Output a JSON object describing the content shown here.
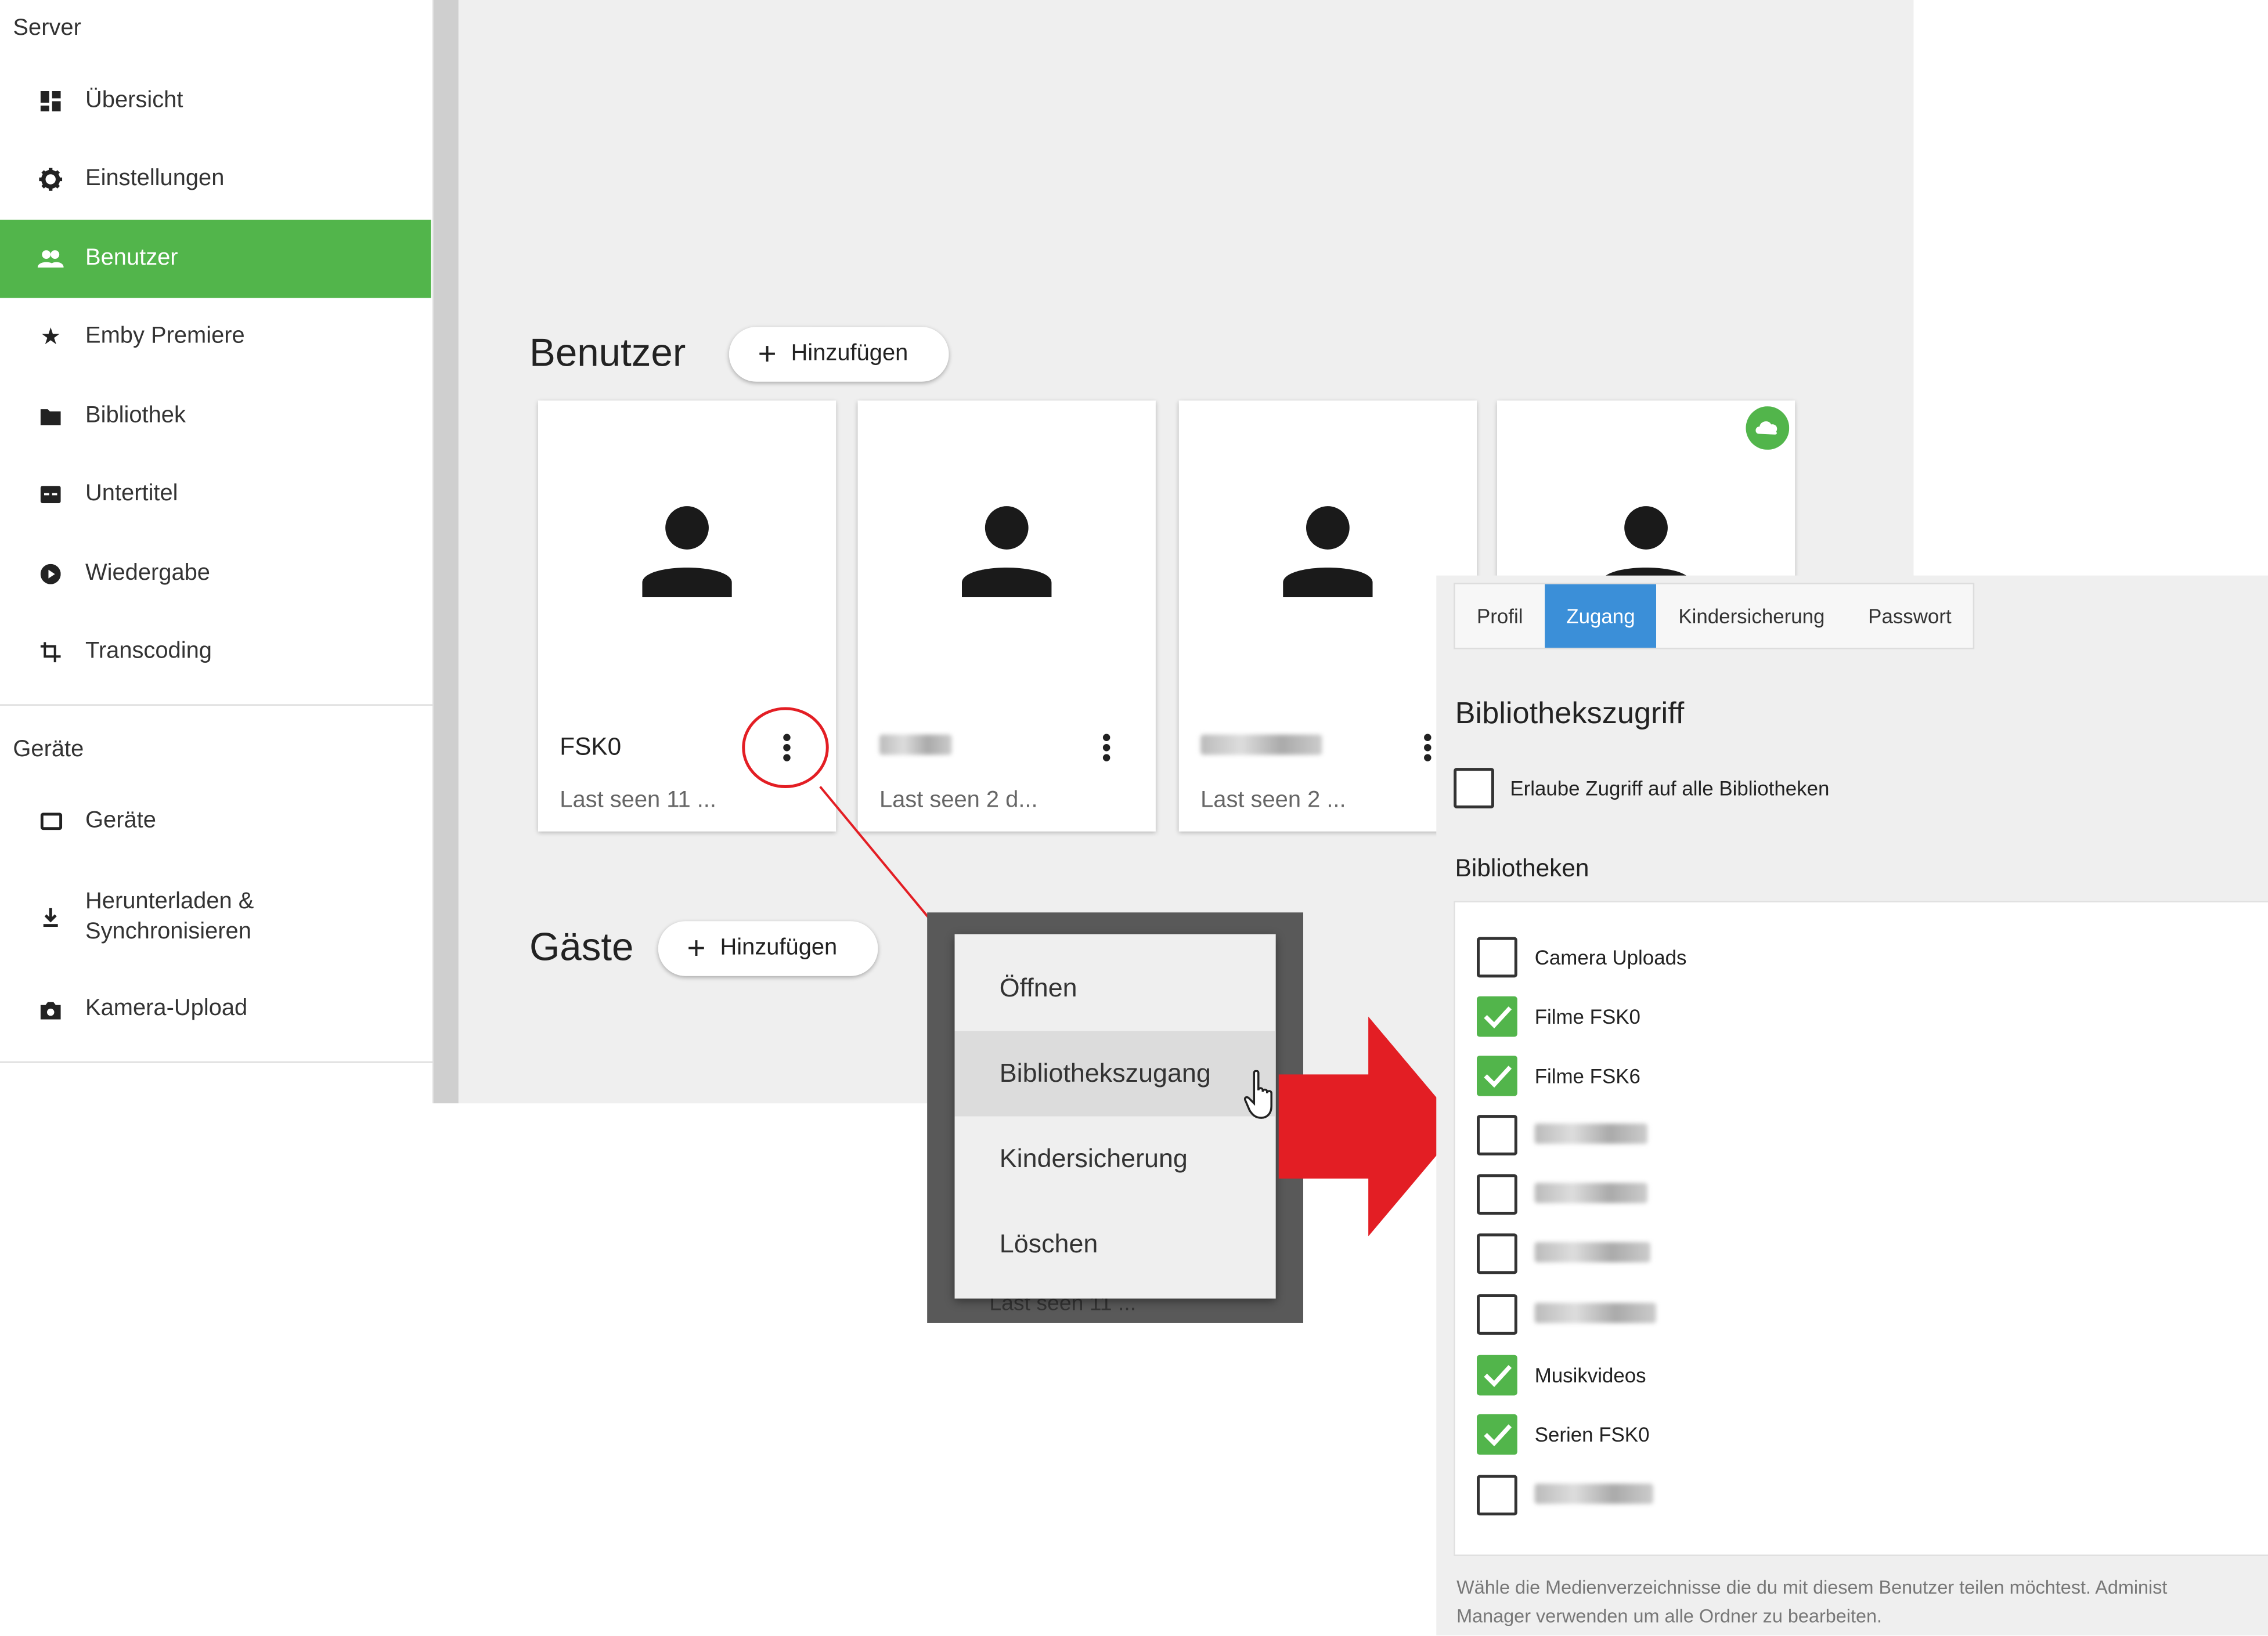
{
  "sidebar": {
    "sections": [
      {
        "title": "Server"
      },
      {
        "title": "Geräte"
      }
    ],
    "server_items": [
      {
        "label": "Übersicht",
        "icon": "dashboard-icon"
      },
      {
        "label": "Einstellungen",
        "icon": "gear-icon"
      },
      {
        "label": "Benutzer",
        "icon": "people-icon",
        "active": true
      },
      {
        "label": "Emby Premiere",
        "icon": "star-icon"
      },
      {
        "label": "Bibliothek",
        "icon": "folder-icon"
      },
      {
        "label": "Untertitel",
        "icon": "subtitles-icon"
      },
      {
        "label": "Wiedergabe",
        "icon": "play-circle-icon"
      },
      {
        "label": "Transcoding",
        "icon": "transform-icon"
      }
    ],
    "device_items": [
      {
        "label": "Geräte",
        "icon": "tablet-icon"
      },
      {
        "label_line1": "Herunterladen &",
        "label_line2": "Synchronisieren",
        "icon": "download-icon"
      },
      {
        "label": "Kamera-Upload",
        "icon": "camera-icon"
      }
    ],
    "active_color": "#52b54b"
  },
  "main": {
    "users_title": "Benutzer",
    "add_label": "Hinzufügen",
    "guests_title": "Gäste",
    "guests_add_label": "Hinzufügen",
    "users": [
      {
        "name": "FSK0",
        "last_seen": "Last seen 11 ..."
      },
      {
        "name": "",
        "last_seen": "Last seen 2 d..."
      },
      {
        "name": "",
        "last_seen": "Last seen 2 ..."
      },
      {
        "name": "",
        "last_seen": "",
        "badge": "cloud-icon"
      }
    ]
  },
  "context_menu": {
    "items": [
      "Öffnen",
      "Bibliothekszugang",
      "Kindersicherung",
      "Löschen"
    ],
    "hovered": "Bibliothekszugang",
    "behind_text": "Last seen 11 ..."
  },
  "panel": {
    "tabs": [
      "Profil",
      "Zugang",
      "Kindersicherung",
      "Passwort"
    ],
    "active_tab": "Zugang",
    "title": "Bibliothekszugriff",
    "allow_all_label": "Erlaube Zugriff auf alle Bibliotheken",
    "allow_all_checked": false,
    "libraries_title": "Bibliotheken",
    "libraries": [
      {
        "label": "Camera Uploads",
        "checked": false
      },
      {
        "label": "Filme FSK0",
        "checked": true
      },
      {
        "label": "Filme FSK6",
        "checked": true
      },
      {
        "label": "",
        "checked": false
      },
      {
        "label": "",
        "checked": false
      },
      {
        "label": "",
        "checked": false
      },
      {
        "label": "",
        "checked": false
      },
      {
        "label": "Musikvideos",
        "checked": true
      },
      {
        "label": "Serien FSK0",
        "checked": true
      },
      {
        "label": "",
        "checked": false
      }
    ],
    "footnote_line1": "Wähle die Medienverzeichnisse die du mit diesem Benutzer teilen möchtest. Administ",
    "footnote_line2": "Manager verwenden um alle Ordner zu bearbeiten."
  },
  "colors": {
    "accent_green": "#52b54b",
    "tab_blue": "#3b8fd8",
    "arrow_red": "#e31e24"
  }
}
